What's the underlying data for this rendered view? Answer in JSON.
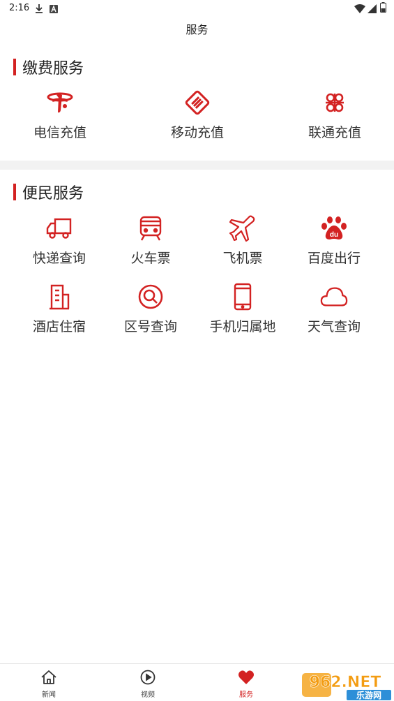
{
  "status_bar": {
    "time": "2:16"
  },
  "header": {
    "title": "服务"
  },
  "payment_section": {
    "title": "缴费服务",
    "items": [
      {
        "label": "电信充值",
        "icon": "china-telecom-icon"
      },
      {
        "label": "移动充值",
        "icon": "china-mobile-icon"
      },
      {
        "label": "联通充值",
        "icon": "china-unicom-icon"
      }
    ]
  },
  "convenience_section": {
    "title": "便民服务",
    "items": [
      {
        "label": "快递查询",
        "icon": "truck-icon"
      },
      {
        "label": "火车票",
        "icon": "train-icon"
      },
      {
        "label": "飞机票",
        "icon": "airplane-icon"
      },
      {
        "label": "百度出行",
        "icon": "baidu-paw-icon"
      },
      {
        "label": "酒店住宿",
        "icon": "building-icon"
      },
      {
        "label": "区号查询",
        "icon": "magnifier-icon"
      },
      {
        "label": "手机归属地",
        "icon": "phone-icon"
      },
      {
        "label": "天气查询",
        "icon": "cloud-icon"
      }
    ]
  },
  "tab_bar": {
    "tabs": [
      {
        "label": "新闻",
        "icon": "home-icon"
      },
      {
        "label": "视频",
        "icon": "play-icon"
      },
      {
        "label": "服务",
        "icon": "heart-icon",
        "active": true
      }
    ]
  },
  "watermark": {
    "brand": "962.NET",
    "sub": "乐游网"
  },
  "colors": {
    "accent": "#d32222",
    "divider": "#f2f2f2"
  }
}
